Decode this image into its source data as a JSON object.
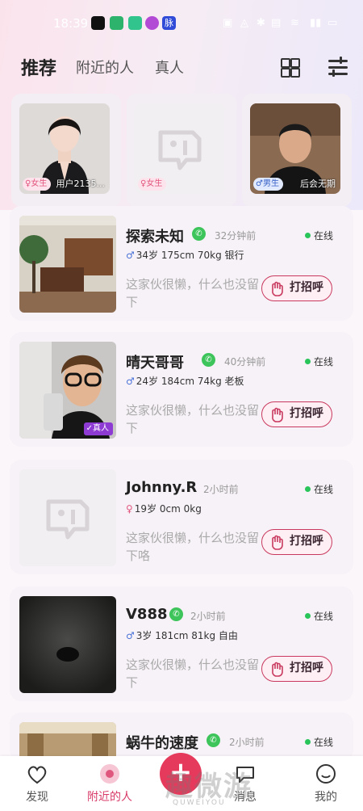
{
  "status_bar": {
    "time": "18:39",
    "app_icons": [
      {
        "name": "douyin-icon",
        "color": "#111111"
      },
      {
        "name": "video-app-icon",
        "color": "#2db36b"
      },
      {
        "name": "notes-app-icon",
        "color": "#31c48d"
      },
      {
        "name": "chat-app-icon",
        "color": "#b34ad6"
      },
      {
        "name": "tantan-app-icon",
        "color": "#2f4bd8",
        "label": "脉"
      }
    ]
  },
  "header": {
    "tabs": [
      "推荐",
      "附近的人",
      "真人"
    ],
    "active_tab": 0
  },
  "top_cards": [
    {
      "badge": "♀女生",
      "name": "用户2135...",
      "photo": "woman"
    },
    {
      "badge": "♀女生",
      "name": "",
      "photo": "placeholder"
    },
    {
      "badge": "♂男生",
      "name": "后会无期",
      "photo": "man"
    }
  ],
  "users": [
    {
      "name": "探索未知",
      "time": "32分钟前",
      "online": "在线",
      "sex": "♂",
      "info": "34岁 175cm 70kg 银行",
      "bio": "这家伙很懒，什么也没留下",
      "greet": "打招呼",
      "photo": "office"
    },
    {
      "name": "晴天哥哥",
      "time": "40分钟前",
      "online": "在线",
      "sex": "♂",
      "info": "24岁 184cm 74kg 老板",
      "bio": "这家伙很懒，什么也没留下",
      "greet": "打招呼",
      "photo": "selfie",
      "tag": "真人"
    },
    {
      "name": "Johnny.R",
      "time": "2小时前",
      "online": "在线",
      "sex": "♀",
      "info": "19岁 0cm 0kg",
      "bio": "这家伙很懒，什么也没留下咯",
      "greet": "打招呼",
      "photo": "placeholder"
    },
    {
      "name": "V888",
      "time": "2小时前",
      "online": "在线",
      "sex": "♂",
      "info": "3岁 181cm 81kg 自由",
      "bio": "这家伙很懒，什么也没留下",
      "greet": "打招呼",
      "photo": "dark"
    },
    {
      "name": "蜗牛的速度",
      "time": "2小时前",
      "online": "在线",
      "photo": "hall"
    }
  ],
  "bottom_nav": [
    {
      "label": "发现",
      "icon": "discover-icon"
    },
    {
      "label": "附近的人",
      "icon": "nearby-icon",
      "active": true
    },
    {
      "label": "",
      "icon": "plus-icon"
    },
    {
      "label": "消息",
      "icon": "message-icon"
    },
    {
      "label": "我的",
      "icon": "profile-icon"
    }
  ],
  "watermark": {
    "text": "趣微游",
    "sub": "QUWEIYOU"
  },
  "colors": {
    "accent": "#d83a67",
    "online": "#29c45a",
    "wechat": "#3dc45a"
  }
}
